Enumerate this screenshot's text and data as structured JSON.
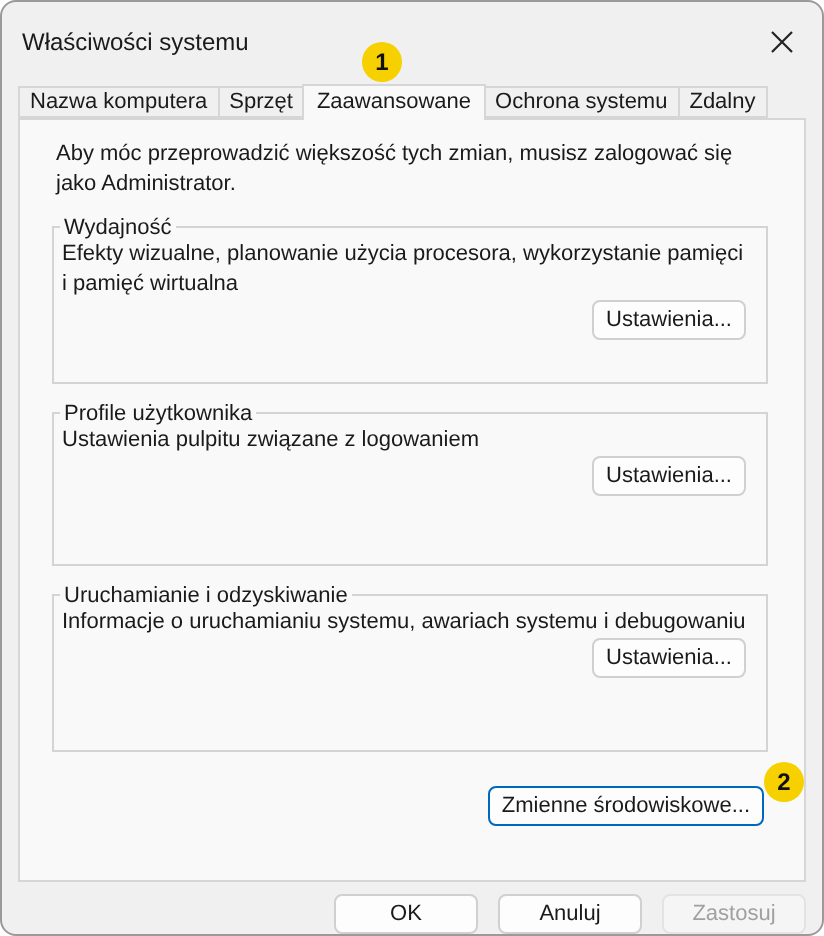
{
  "window": {
    "title": "Właściwości systemu"
  },
  "tabs": [
    {
      "label": "Nazwa komputera",
      "selected": false
    },
    {
      "label": "Sprzęt",
      "selected": false
    },
    {
      "label": "Zaawansowane",
      "selected": true,
      "badge": "1"
    },
    {
      "label": "Ochrona systemu",
      "selected": false
    },
    {
      "label": "Zdalny",
      "selected": false
    }
  ],
  "notice": "Aby móc przeprowadzić większość tych zmian, musisz zalogować się jako Administrator.",
  "groups": [
    {
      "title": "Wydajność",
      "description": "Efekty wizualne, planowanie użycia procesora, wykorzystanie pamięci i pamięć wirtualna",
      "button": "Ustawienia..."
    },
    {
      "title": "Profile użytkownika",
      "description": "Ustawienia pulpitu związane z logowaniem",
      "button": "Ustawienia..."
    },
    {
      "title": "Uruchamianie i odzyskiwanie",
      "description": "Informacje o uruchamianiu systemu, awariach systemu i debugowaniu",
      "button": "Ustawienia..."
    }
  ],
  "environment_button": {
    "label": "Zmienne środowiskowe...",
    "focused": true,
    "badge": "2"
  },
  "buttons": [
    {
      "label": "OK",
      "disabled": false
    },
    {
      "label": "Anuluj",
      "disabled": false
    },
    {
      "label": "Zastosuj",
      "disabled": true
    }
  ]
}
